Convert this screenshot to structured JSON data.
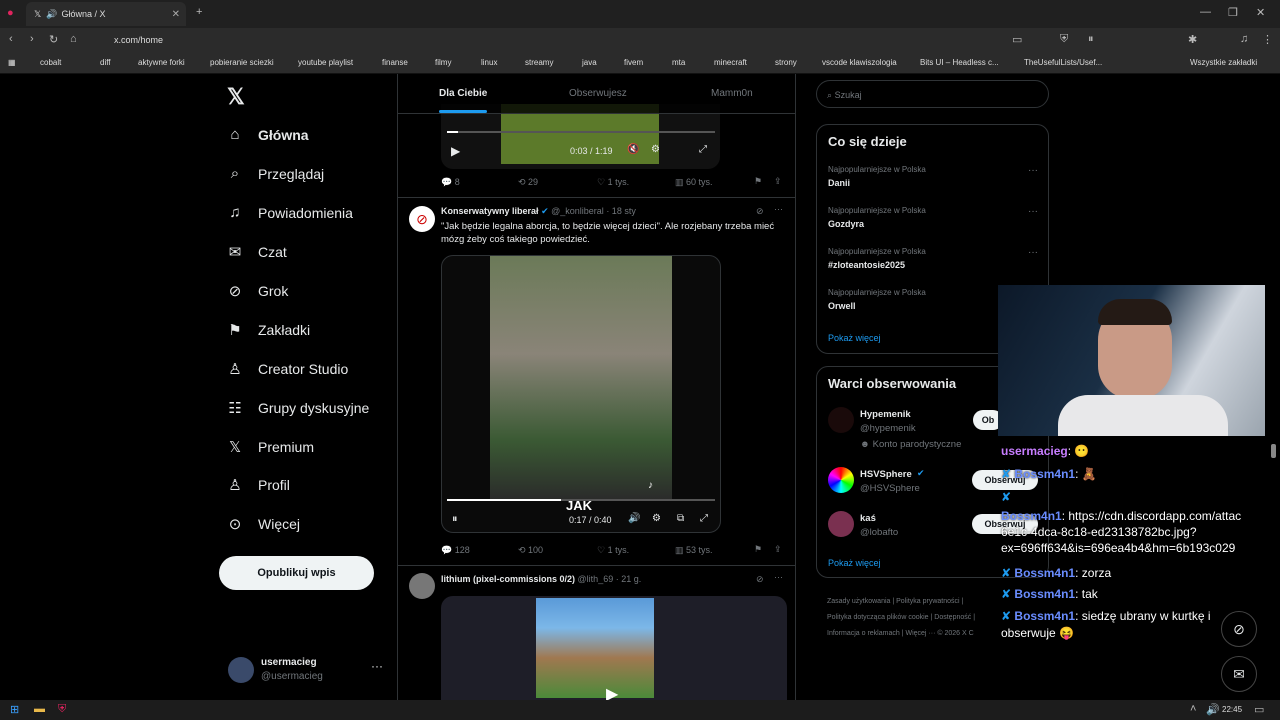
{
  "browser": {
    "tab_title": "Główna / X",
    "url": "x.com/home",
    "bookmarks": [
      "cobalt",
      "diff",
      "aktywne forki",
      "pobieranie sciezki",
      "youtube playlist",
      "finanse",
      "filmy",
      "linux",
      "streamy",
      "java",
      "fivem",
      "mta",
      "minecraft",
      "strony",
      "vscode klawiszologia",
      "Bits UI – Headless c...",
      "TheUsefulLists/Usef..."
    ],
    "all_bookmarks": "Wszystkie zakładki"
  },
  "nav": {
    "items": [
      "Główna",
      "Przeglądaj",
      "Powiadomienia",
      "Czat",
      "Grok",
      "Zakładki",
      "Creator Studio",
      "Grupy dyskusyjne",
      "Premium",
      "Profil",
      "Więcej"
    ],
    "post": "Opublikuj wpis",
    "user_name": "usermacieg",
    "user_handle": "@usermacieg"
  },
  "feed": {
    "tabs": [
      "Dla Ciebie",
      "Obserwujesz",
      "Mamm0n"
    ],
    "post0": {
      "time": "0:03 / 1:19",
      "replies": "8",
      "reposts": "29",
      "likes": "1 tys.",
      "views": "60 tys."
    },
    "post1": {
      "author": "Konserwatywny liberał",
      "handle": "@_konliberal",
      "age": "· 18 sty",
      "text": "\"Jak będzie legalna aborcja, to będzie więcej dzieci\". Ale rozjebany trzeba mieć mózg żeby coś takiego powiedzieć.",
      "caption": "JAK",
      "time": "0:17 / 0:40",
      "replies": "128",
      "reposts": "100",
      "likes": "1 tys.",
      "views": "53 tys."
    },
    "post2": {
      "author": "lithium (pixel-commissions 0/2)",
      "handle": "@lith_69",
      "age": "· 21 g."
    }
  },
  "search": {
    "placeholder": "Szukaj"
  },
  "trends": {
    "title": "Co się dzieje",
    "items": [
      {
        "cat": "Najpopularniejsze w Polska",
        "name": "Danii"
      },
      {
        "cat": "Najpopularniejsze w Polska",
        "name": "Gozdyra"
      },
      {
        "cat": "Najpopularniejsze w Polska",
        "name": "#zloteantosie2025"
      },
      {
        "cat": "Najpopularniejsze w Polska",
        "name": "Orwell"
      }
    ],
    "more": "Pokaż więcej"
  },
  "who": {
    "title": "Warci obserwowania",
    "items": [
      {
        "name": "Hypemenik",
        "handle": "@hypemenik",
        "note": "Konto parodystyczne",
        "btn": "Ob"
      },
      {
        "name": "HSVSphere",
        "handle": "@HSVSphere",
        "btn": "Obserwuj"
      },
      {
        "name": "kaś",
        "handle": "@lobafto",
        "btn": "Obserwuj"
      }
    ],
    "more": "Pokaż więcej"
  },
  "footer": [
    "Zasady użytkowania",
    "Polityka prywatności",
    "Polityka dotycząca plików cookie",
    "Dostępność",
    "Informacja o reklamach",
    "Więcej ···",
    "© 2026 X C"
  ],
  "chat": [
    {
      "user": "usermacieg",
      "msg": ""
    },
    {
      "user": "Bossm4n1",
      "msg": ""
    },
    {
      "user": "Bossm4n1",
      "msg": "https://cdn.discordapp.com/attac 6e1c-4dca-8c18-ed23138782bc.jpg? ex=696ff634&is=696ea4b4&hm=6b193c029"
    },
    {
      "user": "Bossm4n1",
      "msg": "zorza"
    },
    {
      "user": "Bossm4n1",
      "msg": "tak"
    },
    {
      "user": "Bossm4n1",
      "msg": "siedzę ubrany w kurtkę i obserwuje 😝"
    }
  ],
  "taskbar": {
    "time": "22:45"
  }
}
